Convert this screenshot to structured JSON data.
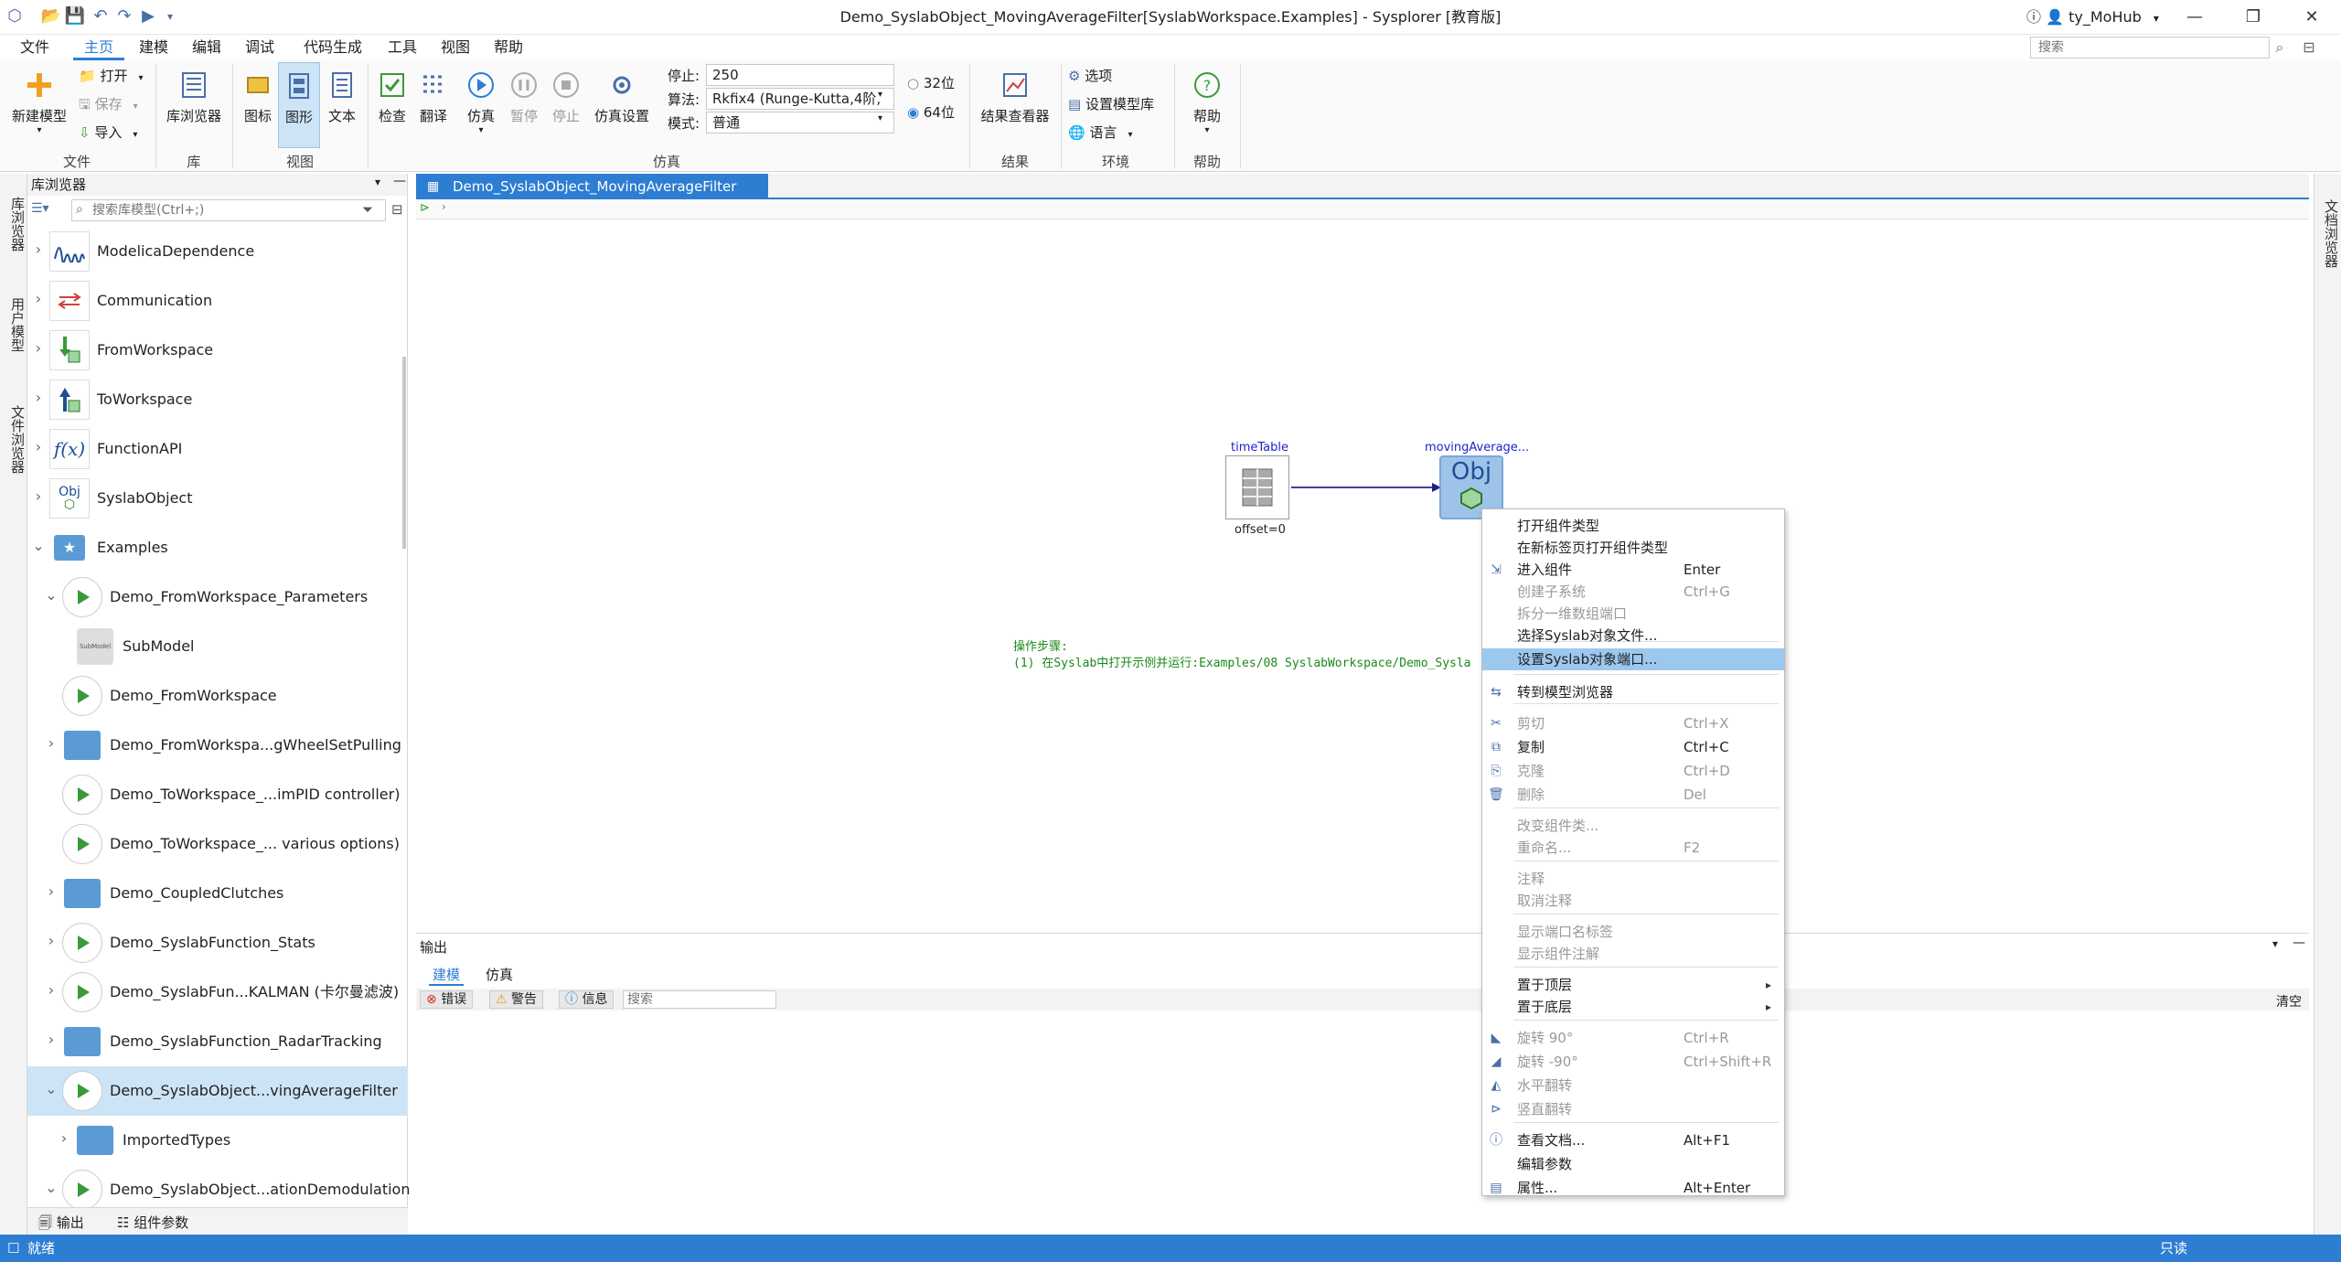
{
  "window": {
    "title": "Demo_SyslabObject_MovingAverageFilter[SyslabWorkspace.Examples] - Sysplorer [教育版]",
    "user": "ty_MoHub",
    "search_placeholder": "搜索"
  },
  "menu": [
    "文件",
    "主页",
    "建模",
    "编辑",
    "调试",
    "代码生成",
    "工具",
    "视图",
    "帮助"
  ],
  "ribbon": {
    "file": {
      "new_model": "新建模型",
      "open": "打开",
      "save": "保存",
      "import": "导入",
      "group": "文件"
    },
    "lib": {
      "browser": "库浏览器",
      "group": "库"
    },
    "view": {
      "icon": "图标",
      "diagram": "图形",
      "text": "文本",
      "group": "视图"
    },
    "sim": {
      "check": "检查",
      "translate": "翻译",
      "simulate": "仿真",
      "pause": "暂停",
      "stop": "停止",
      "settings": "仿真设置",
      "stop_label": "停止:",
      "stop_value": "250",
      "algo_label": "算法:",
      "algo_value": "Rkfix4 (Runge-Kutta,4阶,",
      "mode_label": "模式:",
      "mode_value": "普通",
      "bit32": "32位",
      "bit64": "64位",
      "group": "仿真"
    },
    "results": {
      "viewer": "结果查看器",
      "group": "结果"
    },
    "env": {
      "options": "选项",
      "model_lib": "设置模型库",
      "language": "语言",
      "group": "环境"
    },
    "help": {
      "help": "帮助",
      "group": "帮助"
    }
  },
  "lib_panel": {
    "title": "库浏览器",
    "search_placeholder": "搜索库模型(Ctrl+;)",
    "items": [
      {
        "label": "ModelicaDependence"
      },
      {
        "label": "Communication"
      },
      {
        "label": "FromWorkspace"
      },
      {
        "label": "ToWorkspace"
      },
      {
        "label": "FunctionAPI"
      },
      {
        "label": "SyslabObject"
      },
      {
        "label": "Examples"
      },
      {
        "label": "Demo_FromWorkspace_Parameters"
      },
      {
        "label": "SubModel"
      },
      {
        "label": "Demo_FromWorkspace"
      },
      {
        "label": "Demo_FromWorkspa...gWheelSetPulling"
      },
      {
        "label": "Demo_ToWorkspace_...imPID controller)"
      },
      {
        "label": "Demo_ToWorkspace_... various options)"
      },
      {
        "label": "Demo_CoupledClutches"
      },
      {
        "label": "Demo_SyslabFunction_Stats"
      },
      {
        "label": "Demo_SyslabFun...KALMAN (卡尔曼滤波)"
      },
      {
        "label": "Demo_SyslabFunction_RadarTracking"
      },
      {
        "label": "Demo_SyslabObject...vingAverageFilter"
      },
      {
        "label": "ImportedTypes"
      },
      {
        "label": "Demo_SyslabObject...ationDemodulation"
      }
    ]
  },
  "left_vtabs": [
    "库浏览器",
    "用户模型",
    "文件浏览器"
  ],
  "right_vtabs": [
    "文档浏览器"
  ],
  "doc_tab": "Demo_SyslabObject_MovingAverageFilter",
  "canvas": {
    "comp1": {
      "name": "timeTable",
      "param": "offset=0"
    },
    "comp2": {
      "name": "movingAverage...",
      "icon_text": "Obj"
    },
    "note_line1": "操作步骤:",
    "note_line2": "(1) 在Syslab中打开示例并运行:Examples/08 SyslabWorkspace/Demo_Sysla"
  },
  "output": {
    "title": "输出",
    "tabs": [
      "建模",
      "仿真"
    ],
    "filters": {
      "error": "错误",
      "warning": "警告",
      "info": "信息"
    },
    "search_placeholder": "搜索",
    "clear": "清空"
  },
  "context_menu": [
    {
      "label": "打开组件类型",
      "shortcut": ""
    },
    {
      "label": "在新标签页打开组件类型",
      "shortcut": ""
    },
    {
      "label": "进入组件",
      "shortcut": "Enter"
    },
    {
      "label": "创建子系统",
      "shortcut": "Ctrl+G"
    },
    {
      "label": "拆分一维数组端口",
      "shortcut": ""
    },
    {
      "label": "选择Syslab对象文件...",
      "shortcut": ""
    },
    {
      "label": "设置Syslab对象端口...",
      "shortcut": ""
    },
    {
      "label": "转到模型浏览器",
      "shortcut": ""
    },
    {
      "label": "剪切",
      "shortcut": "Ctrl+X"
    },
    {
      "label": "复制",
      "shortcut": "Ctrl+C"
    },
    {
      "label": "克隆",
      "shortcut": "Ctrl+D"
    },
    {
      "label": "删除",
      "shortcut": "Del"
    },
    {
      "label": "改变组件类...",
      "shortcut": ""
    },
    {
      "label": "重命名...",
      "shortcut": "F2"
    },
    {
      "label": "注释",
      "shortcut": ""
    },
    {
      "label": "取消注释",
      "shortcut": ""
    },
    {
      "label": "显示端口名标签",
      "shortcut": ""
    },
    {
      "label": "显示组件注解",
      "shortcut": ""
    },
    {
      "label": "置于顶层",
      "shortcut": ""
    },
    {
      "label": "置于底层",
      "shortcut": ""
    },
    {
      "label": "旋转 90°",
      "shortcut": "Ctrl+R"
    },
    {
      "label": "旋转 -90°",
      "shortcut": "Ctrl+Shift+R"
    },
    {
      "label": "水平翻转",
      "shortcut": ""
    },
    {
      "label": "竖直翻转",
      "shortcut": ""
    },
    {
      "label": "查看文档...",
      "shortcut": "Alt+F1"
    },
    {
      "label": "编辑参数",
      "shortcut": ""
    },
    {
      "label": "属性...",
      "shortcut": "Alt+Enter"
    }
  ],
  "bottom_tabs": {
    "output": "输出",
    "params": "组件参数"
  },
  "status": {
    "left": "就绪",
    "right": "只读"
  }
}
